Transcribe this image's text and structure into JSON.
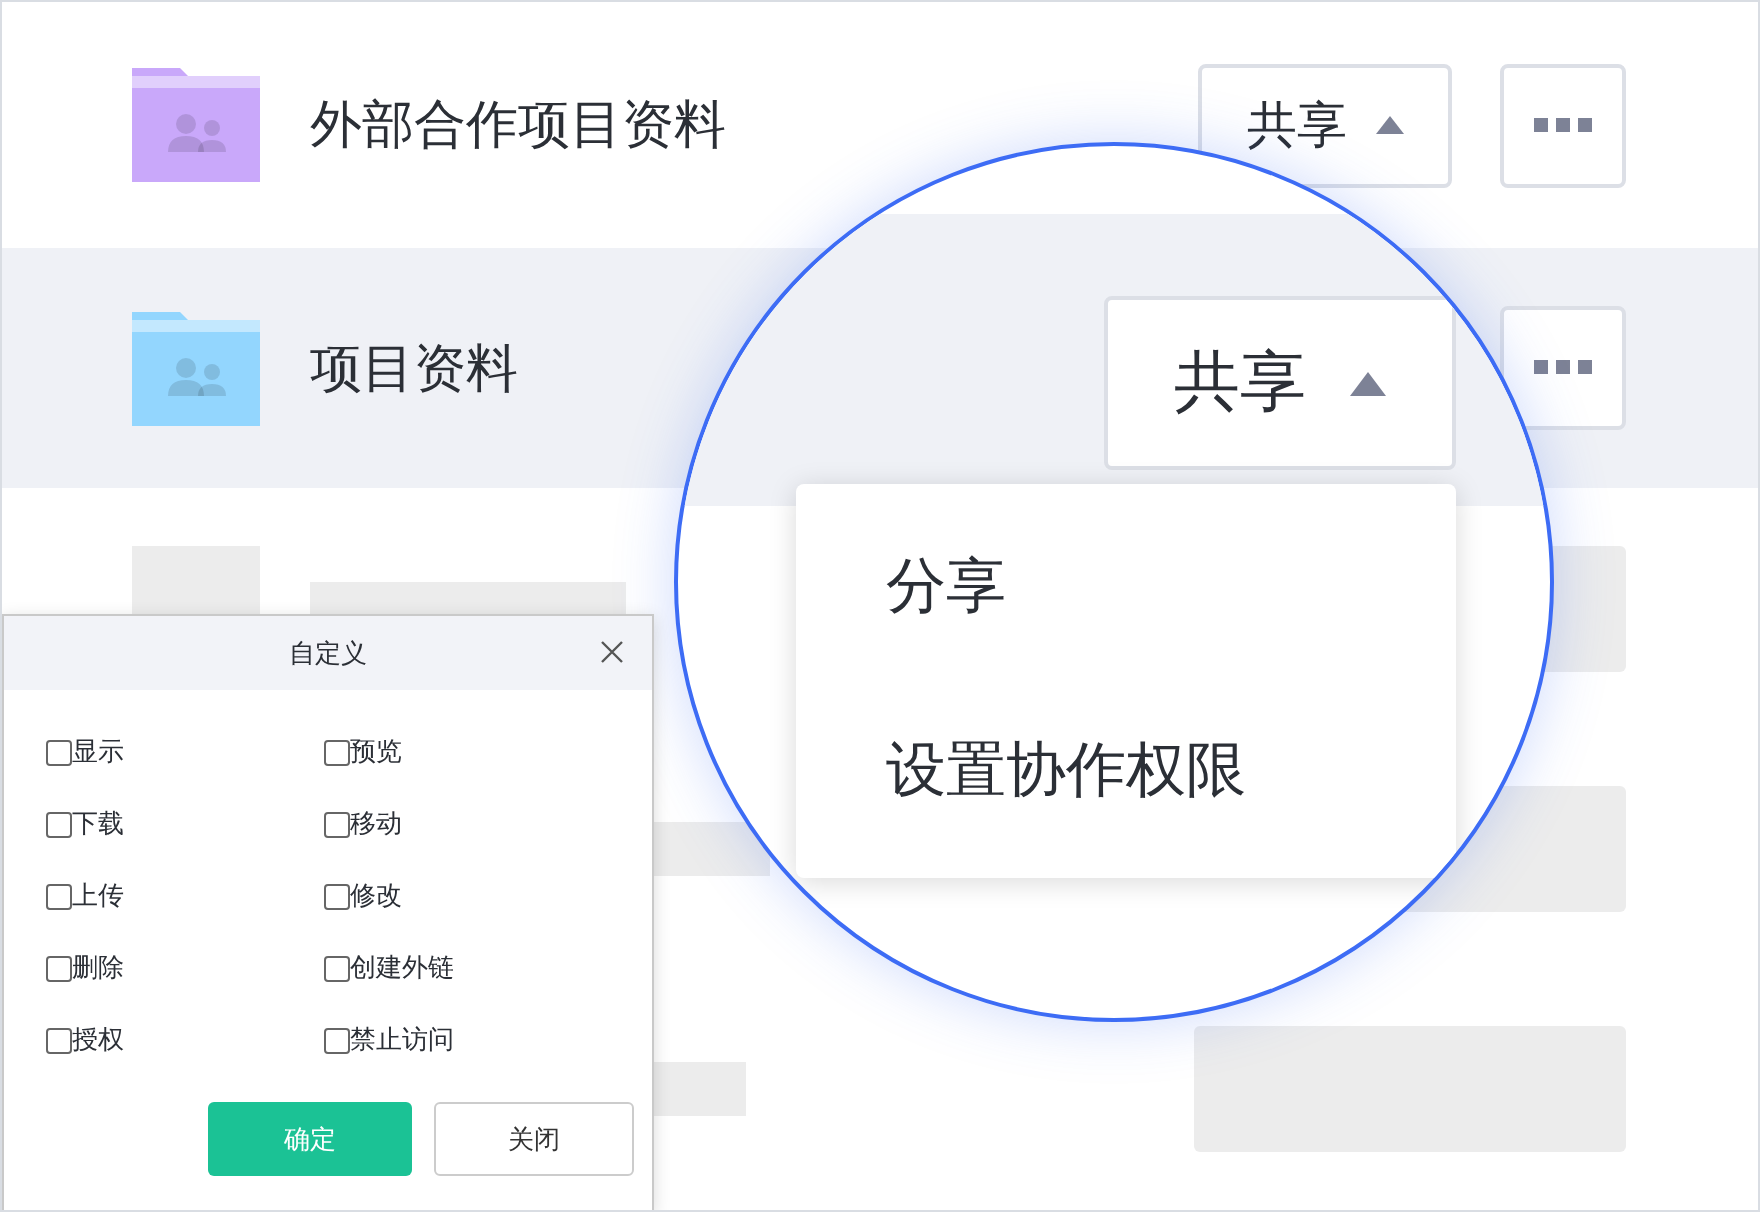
{
  "rows": [
    {
      "name": "外部合作项目资料",
      "color": "#c9a8fa",
      "share_label": "共享",
      "selected": false
    },
    {
      "name": "项目资料",
      "color": "#93d6fe",
      "selected": true
    }
  ],
  "magnifier": {
    "share_label": "共享",
    "menu": [
      "分享",
      "设置协作权限"
    ]
  },
  "dialog": {
    "title": "自定义",
    "options": [
      {
        "label": "显示",
        "checked": false
      },
      {
        "label": "预览",
        "checked": false
      },
      {
        "label": "下载",
        "checked": false
      },
      {
        "label": "移动",
        "checked": false
      },
      {
        "label": "上传",
        "checked": false
      },
      {
        "label": "修改",
        "checked": false
      },
      {
        "label": "删除",
        "checked": false
      },
      {
        "label": "创建外链",
        "checked": false
      },
      {
        "label": "授权",
        "checked": false
      },
      {
        "label": "禁止访问",
        "checked": false
      }
    ],
    "confirm": "确定",
    "close": "关闭"
  }
}
